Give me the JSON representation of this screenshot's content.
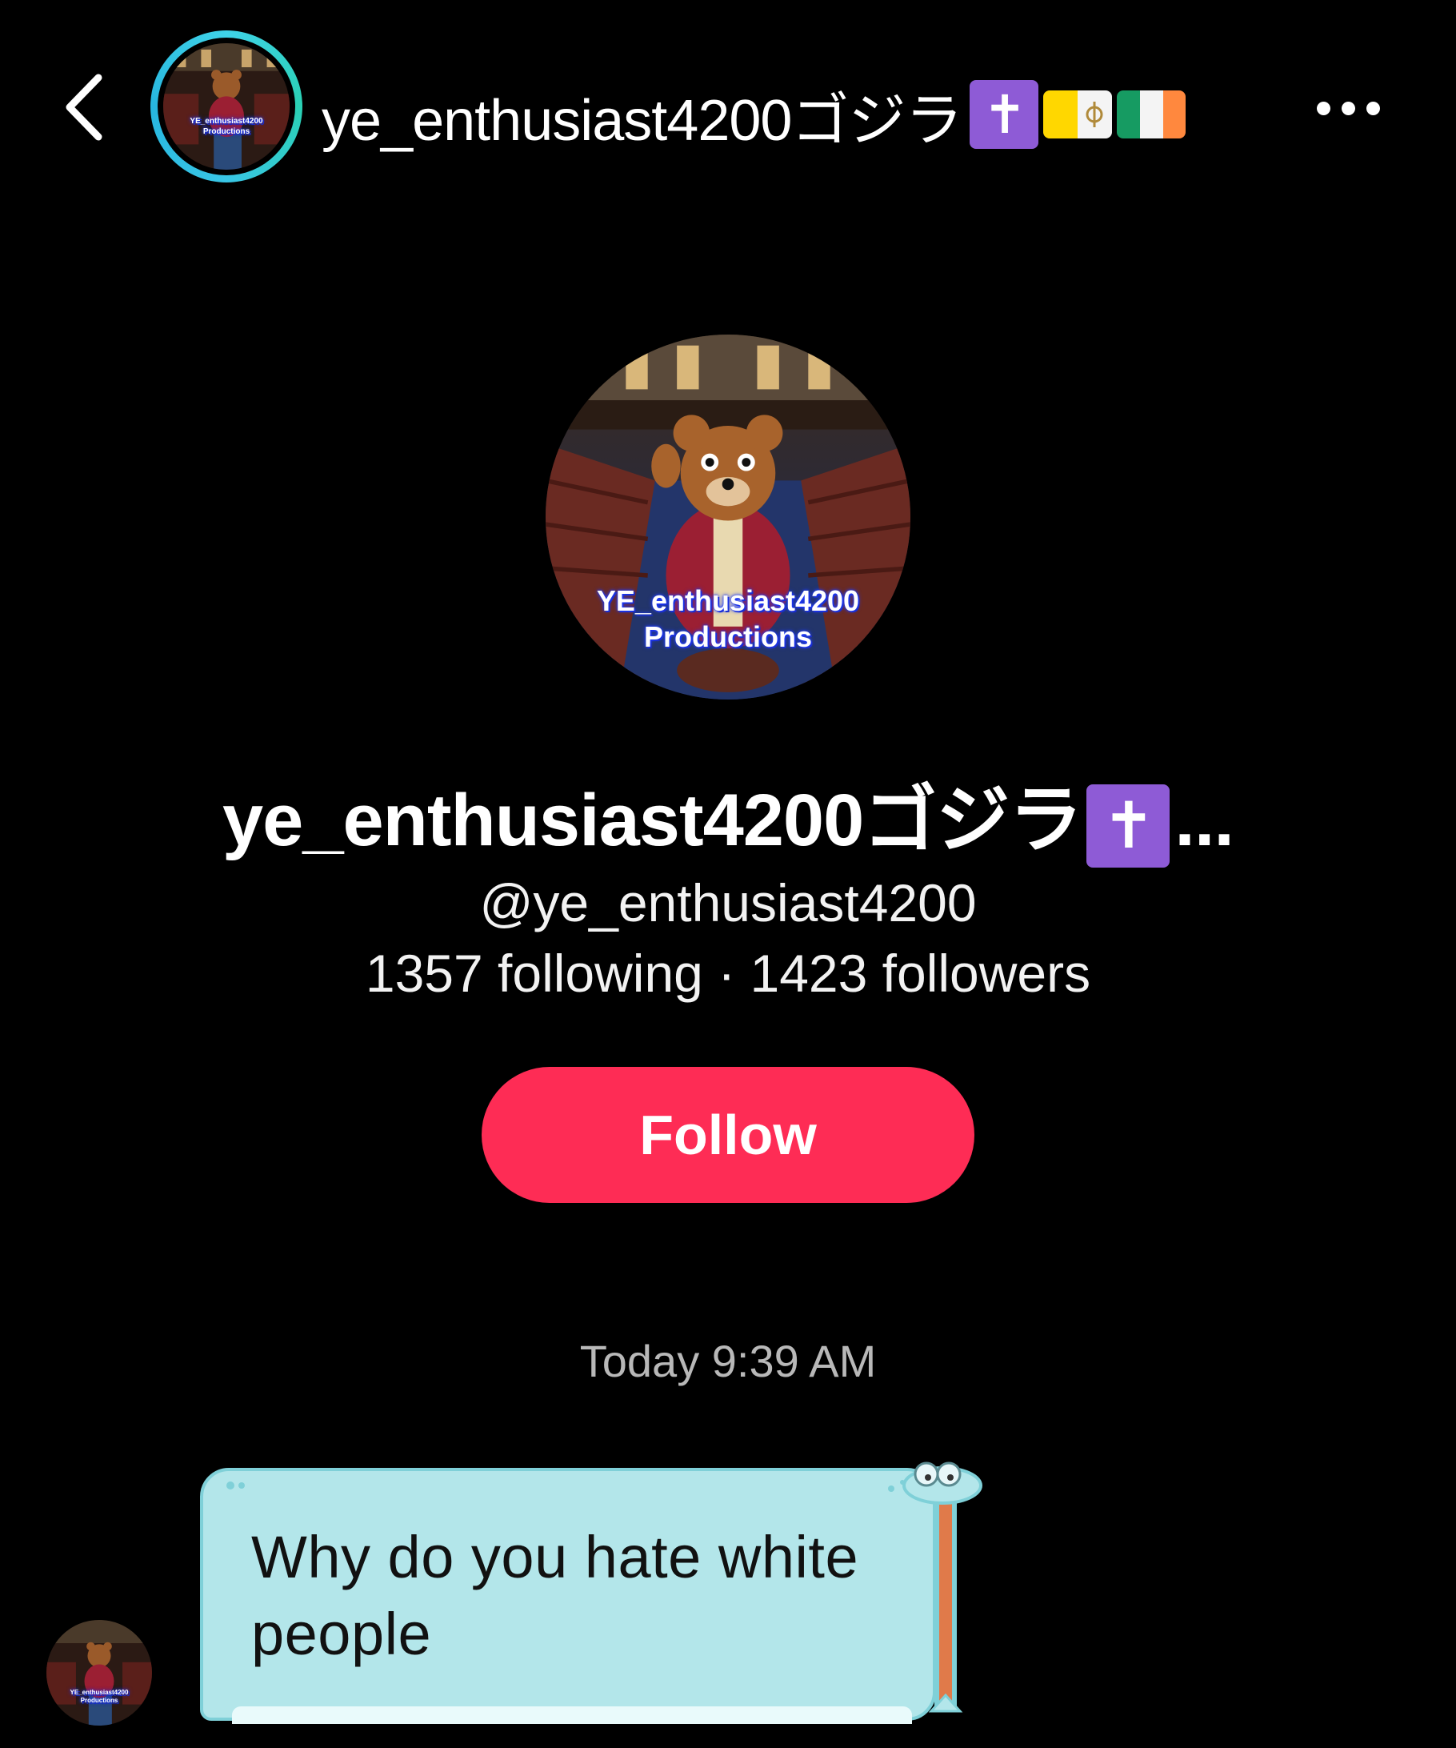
{
  "header": {
    "back_icon": "chevron-left-icon",
    "username": "ye_enthusiast4200ゴジラ",
    "emoji_cross": "✝",
    "flags": [
      "vatican-flag",
      "ireland-flag"
    ],
    "more_icon": "ellipsis-icon"
  },
  "profile": {
    "avatar_caption_line1": "YE_enthusiast4200",
    "avatar_caption_line2": "Productions",
    "display_name": "ye_enthusiast4200ゴジラ",
    "display_name_emoji": "✝",
    "display_name_ellipsis": "...",
    "handle": "@ye_enthusiast4200",
    "following": "1357 following",
    "separator": " · ",
    "followers": "1423 followers",
    "follow_label": "Follow"
  },
  "chat": {
    "timestamp": "Today 9:39 AM",
    "messages": [
      {
        "text": "Why do you hate white people",
        "sender": "ye_enthusiast4200"
      }
    ]
  },
  "colors": {
    "background": "#000000",
    "follow_button": "#fe2c55",
    "avatar_ring": "#3fd3e8",
    "bubble_fill": "#b3e6ea",
    "bubble_border": "#7fd0d8",
    "timestamp_text": "#b8b8b8",
    "emoji_cross_bg": "#8e5bd6"
  }
}
